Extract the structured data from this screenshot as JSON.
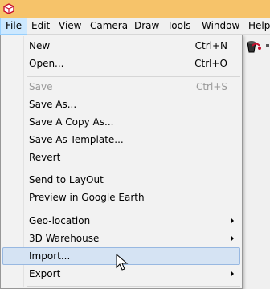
{
  "app": {
    "icon": "sketchup-icon"
  },
  "menubar": {
    "items": [
      {
        "label": "File"
      },
      {
        "label": "Edit"
      },
      {
        "label": "View"
      },
      {
        "label": "Camera"
      },
      {
        "label": "Draw"
      },
      {
        "label": "Tools"
      },
      {
        "label": "Window"
      },
      {
        "label": "Help"
      }
    ],
    "active": "File"
  },
  "file_menu": {
    "items": [
      {
        "label": "New",
        "shortcut": "Ctrl+N"
      },
      {
        "label": "Open...",
        "shortcut": "Ctrl+O"
      },
      {
        "label": "Save",
        "shortcut": "Ctrl+S",
        "disabled": true
      },
      {
        "label": "Save As..."
      },
      {
        "label": "Save A Copy As..."
      },
      {
        "label": "Save As Template..."
      },
      {
        "label": "Revert"
      },
      {
        "label": "Send to LayOut"
      },
      {
        "label": "Preview in Google Earth"
      },
      {
        "label": "Geo-location",
        "submenu": true
      },
      {
        "label": "3D Warehouse",
        "submenu": true
      },
      {
        "label": "Import...",
        "hovered": true
      },
      {
        "label": "Export",
        "submenu": true
      }
    ]
  },
  "colors": {
    "title_bar": "#f6c36a",
    "menu_active_bg": "#cce8ff",
    "hover_bg": "#d5e3f3",
    "hover_border": "#98b8e1",
    "disabled_text": "#9a9a9a"
  }
}
